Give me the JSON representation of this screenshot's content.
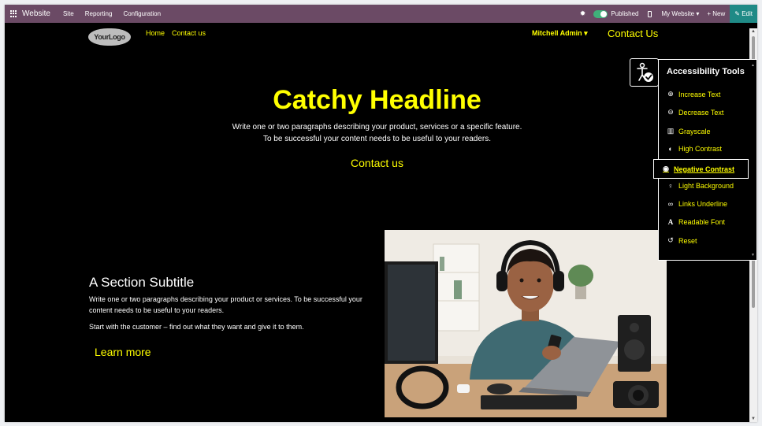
{
  "topbar": {
    "app_name": "Website",
    "menu": [
      "Site",
      "Reporting",
      "Configuration"
    ],
    "published_label": "Published",
    "website_selector": "My Website ▾",
    "new_label": "+ New",
    "edit_label": "✎ Edit"
  },
  "header": {
    "logo_text": "YourLogo",
    "nav": [
      "Home",
      "Contact us"
    ],
    "user": "Mitchell Admin ▾",
    "cta": "Contact Us"
  },
  "hero": {
    "headline": "Catchy Headline",
    "line1": "Write one or two paragraphs describing your product, services or a specific feature.",
    "line2": "To be successful your content needs to be useful to your readers.",
    "cta": "Contact us"
  },
  "section": {
    "subtitle": "A Section Subtitle",
    "paragraph1": "Write one or two paragraphs describing your product or services. To be successful your content needs to be useful to your readers.",
    "paragraph2": "Start with the customer – find out what they want and give it to them.",
    "cta": "Learn more"
  },
  "accessibility": {
    "title": "Accessibility Tools",
    "items": [
      {
        "label": "Increase Text",
        "icon": "zoom-in-icon"
      },
      {
        "label": "Decrease Text",
        "icon": "zoom-out-icon"
      },
      {
        "label": "Grayscale",
        "icon": "barcode-icon"
      },
      {
        "label": "High Contrast",
        "icon": "contrast-icon"
      },
      {
        "label": "Negative Contrast",
        "icon": "eye-icon"
      },
      {
        "label": "Light Background",
        "icon": "lightbulb-icon"
      },
      {
        "label": "Links Underline",
        "icon": "link-icon"
      },
      {
        "label": "Readable Font",
        "icon": "font-icon"
      },
      {
        "label": "Reset",
        "icon": "reset-icon"
      }
    ],
    "active": "Negative Contrast"
  },
  "colors": {
    "topbar": "#6b4a65",
    "accent_yellow": "#ffff00",
    "published_green": "#3fb07a",
    "edit_teal": "#1f8a86"
  }
}
